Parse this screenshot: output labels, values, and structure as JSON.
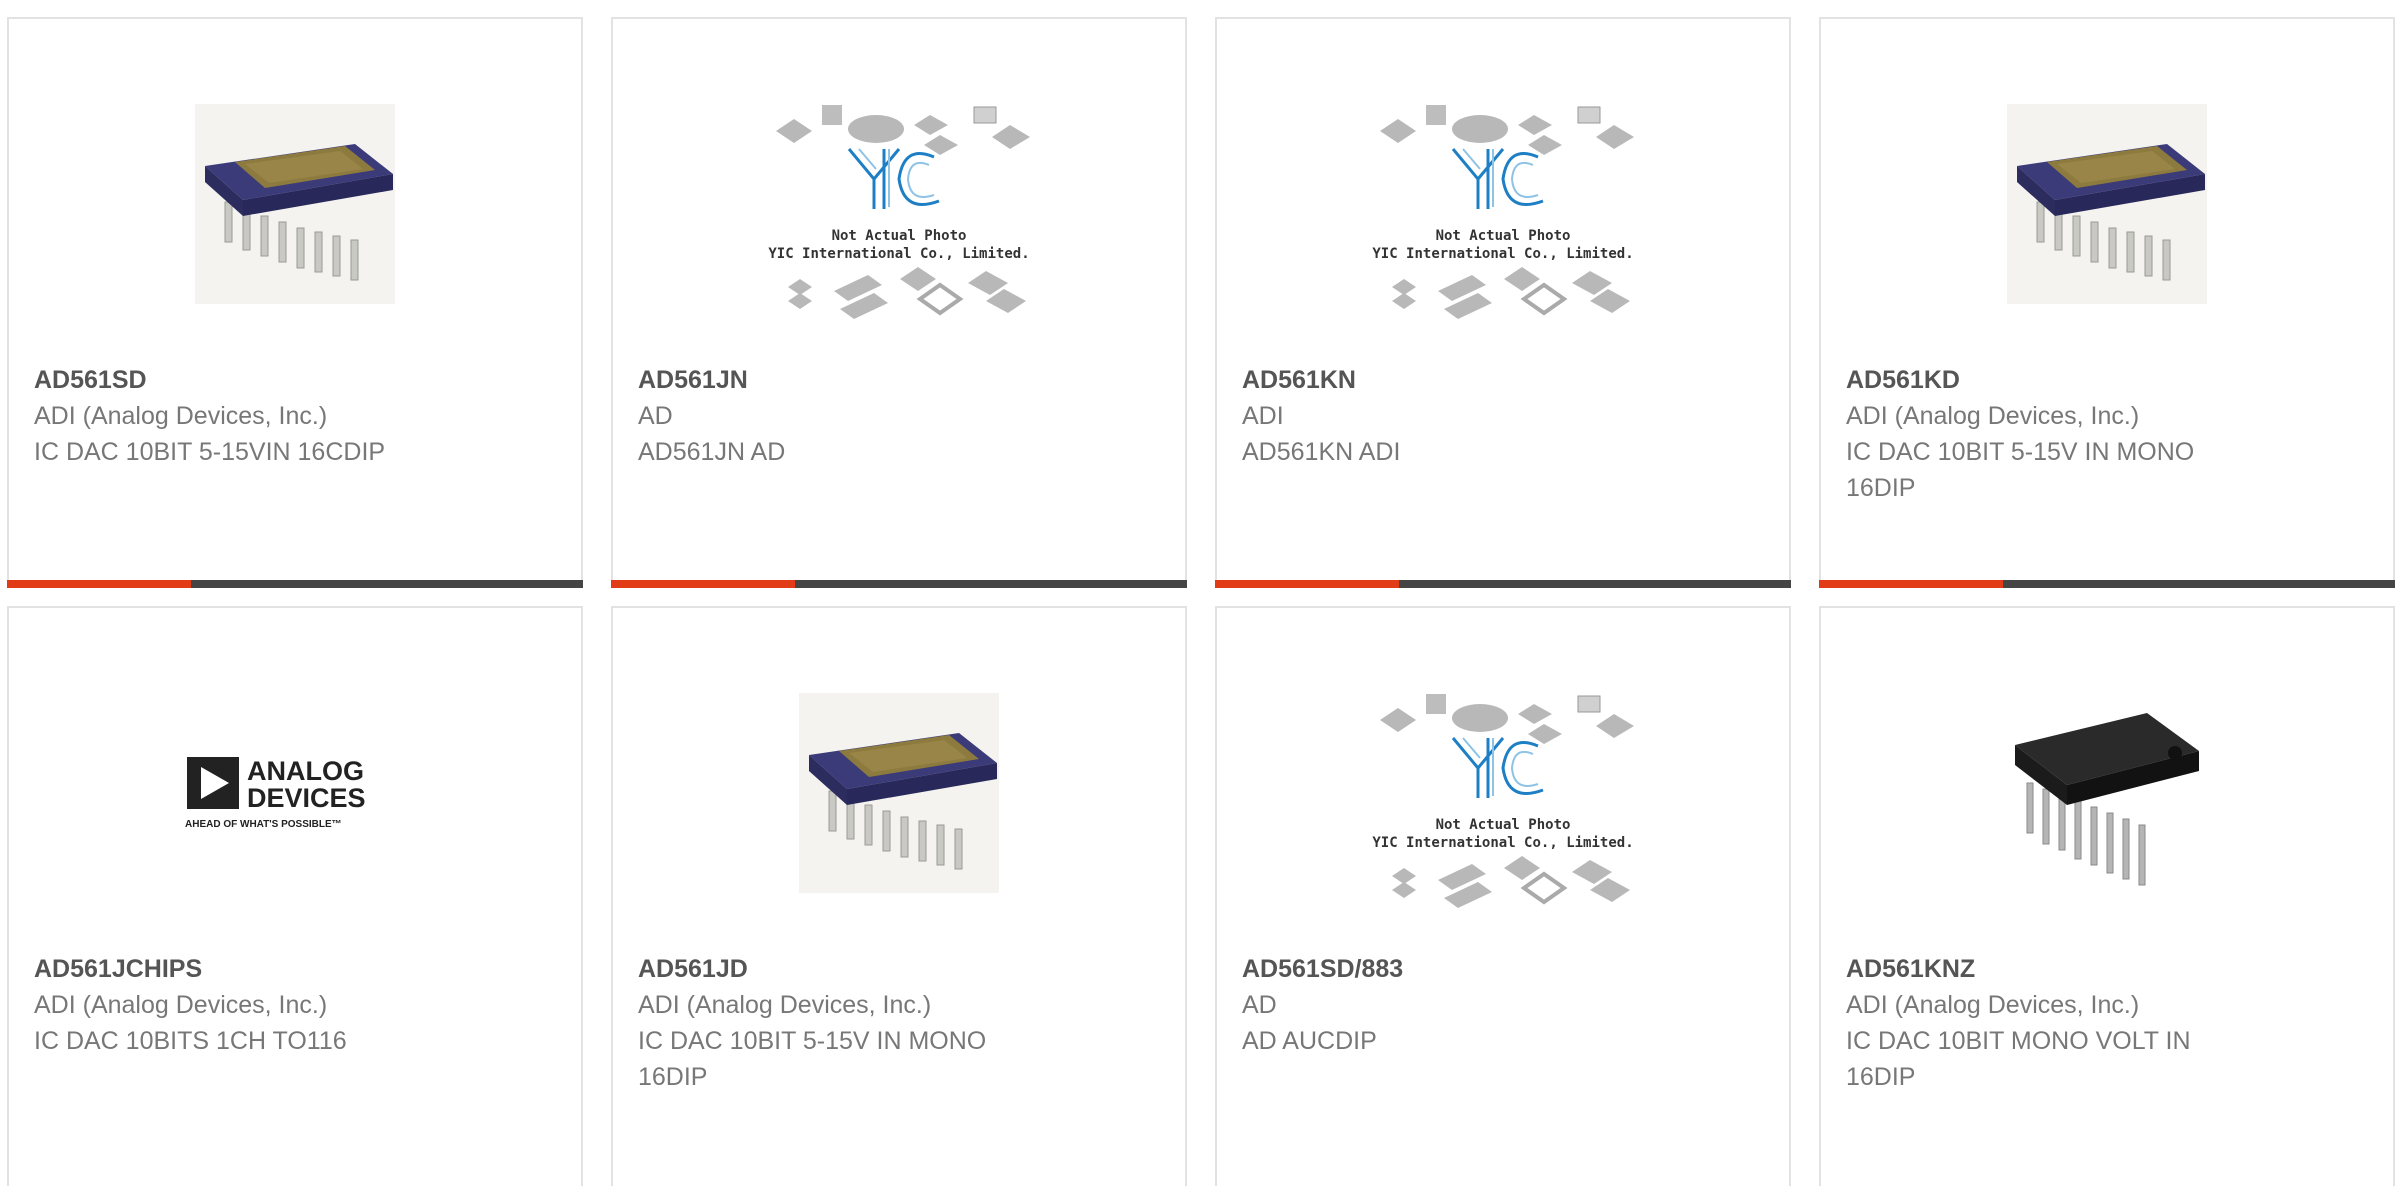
{
  "colors": {
    "accent": "#e23c17",
    "bar": "#454545",
    "title": "#555555",
    "text": "#777777"
  },
  "placeholder": {
    "line1": "Not Actual Photo",
    "line2": "YIC International Co., Limited.",
    "logo": "YIC"
  },
  "logo_adi": {
    "line1": "ANALOG",
    "line2": "DEVICES",
    "tagline": "AHEAD OF WHAT'S POSSIBLE™"
  },
  "products": [
    {
      "part": "AD561SD",
      "manufacturer": "ADI (Analog Devices, Inc.)",
      "description": "IC DAC 10BIT 5-15VIN 16CDIP",
      "image": "ceramic-dip-photo"
    },
    {
      "part": "AD561JN",
      "manufacturer": "AD",
      "description": "AD561JN AD",
      "image": "not-actual-photo"
    },
    {
      "part": "AD561KN",
      "manufacturer": "ADI",
      "description": "AD561KN ADI",
      "image": "not-actual-photo"
    },
    {
      "part": "AD561KD",
      "manufacturer": "ADI (Analog Devices, Inc.)",
      "description": "IC DAC 10BIT 5-15V IN MONO 16DIP",
      "image": "ceramic-dip-photo"
    },
    {
      "part": "AD561JCHIPS",
      "manufacturer": "ADI (Analog Devices, Inc.)",
      "description": "IC DAC 10BITS 1CH TO116",
      "image": "analog-devices-logo"
    },
    {
      "part": "AD561JD",
      "manufacturer": "ADI (Analog Devices, Inc.)",
      "description": "IC DAC 10BIT 5-15V IN MONO 16DIP",
      "image": "ceramic-dip-photo"
    },
    {
      "part": "AD561SD/883",
      "manufacturer": "AD",
      "description": "AD AUCDIP",
      "image": "not-actual-photo"
    },
    {
      "part": "AD561KNZ",
      "manufacturer": "ADI (Analog Devices, Inc.)",
      "description": "IC DAC 10BIT MONO VOLT IN 16DIP",
      "image": "plastic-dip-photo"
    }
  ]
}
